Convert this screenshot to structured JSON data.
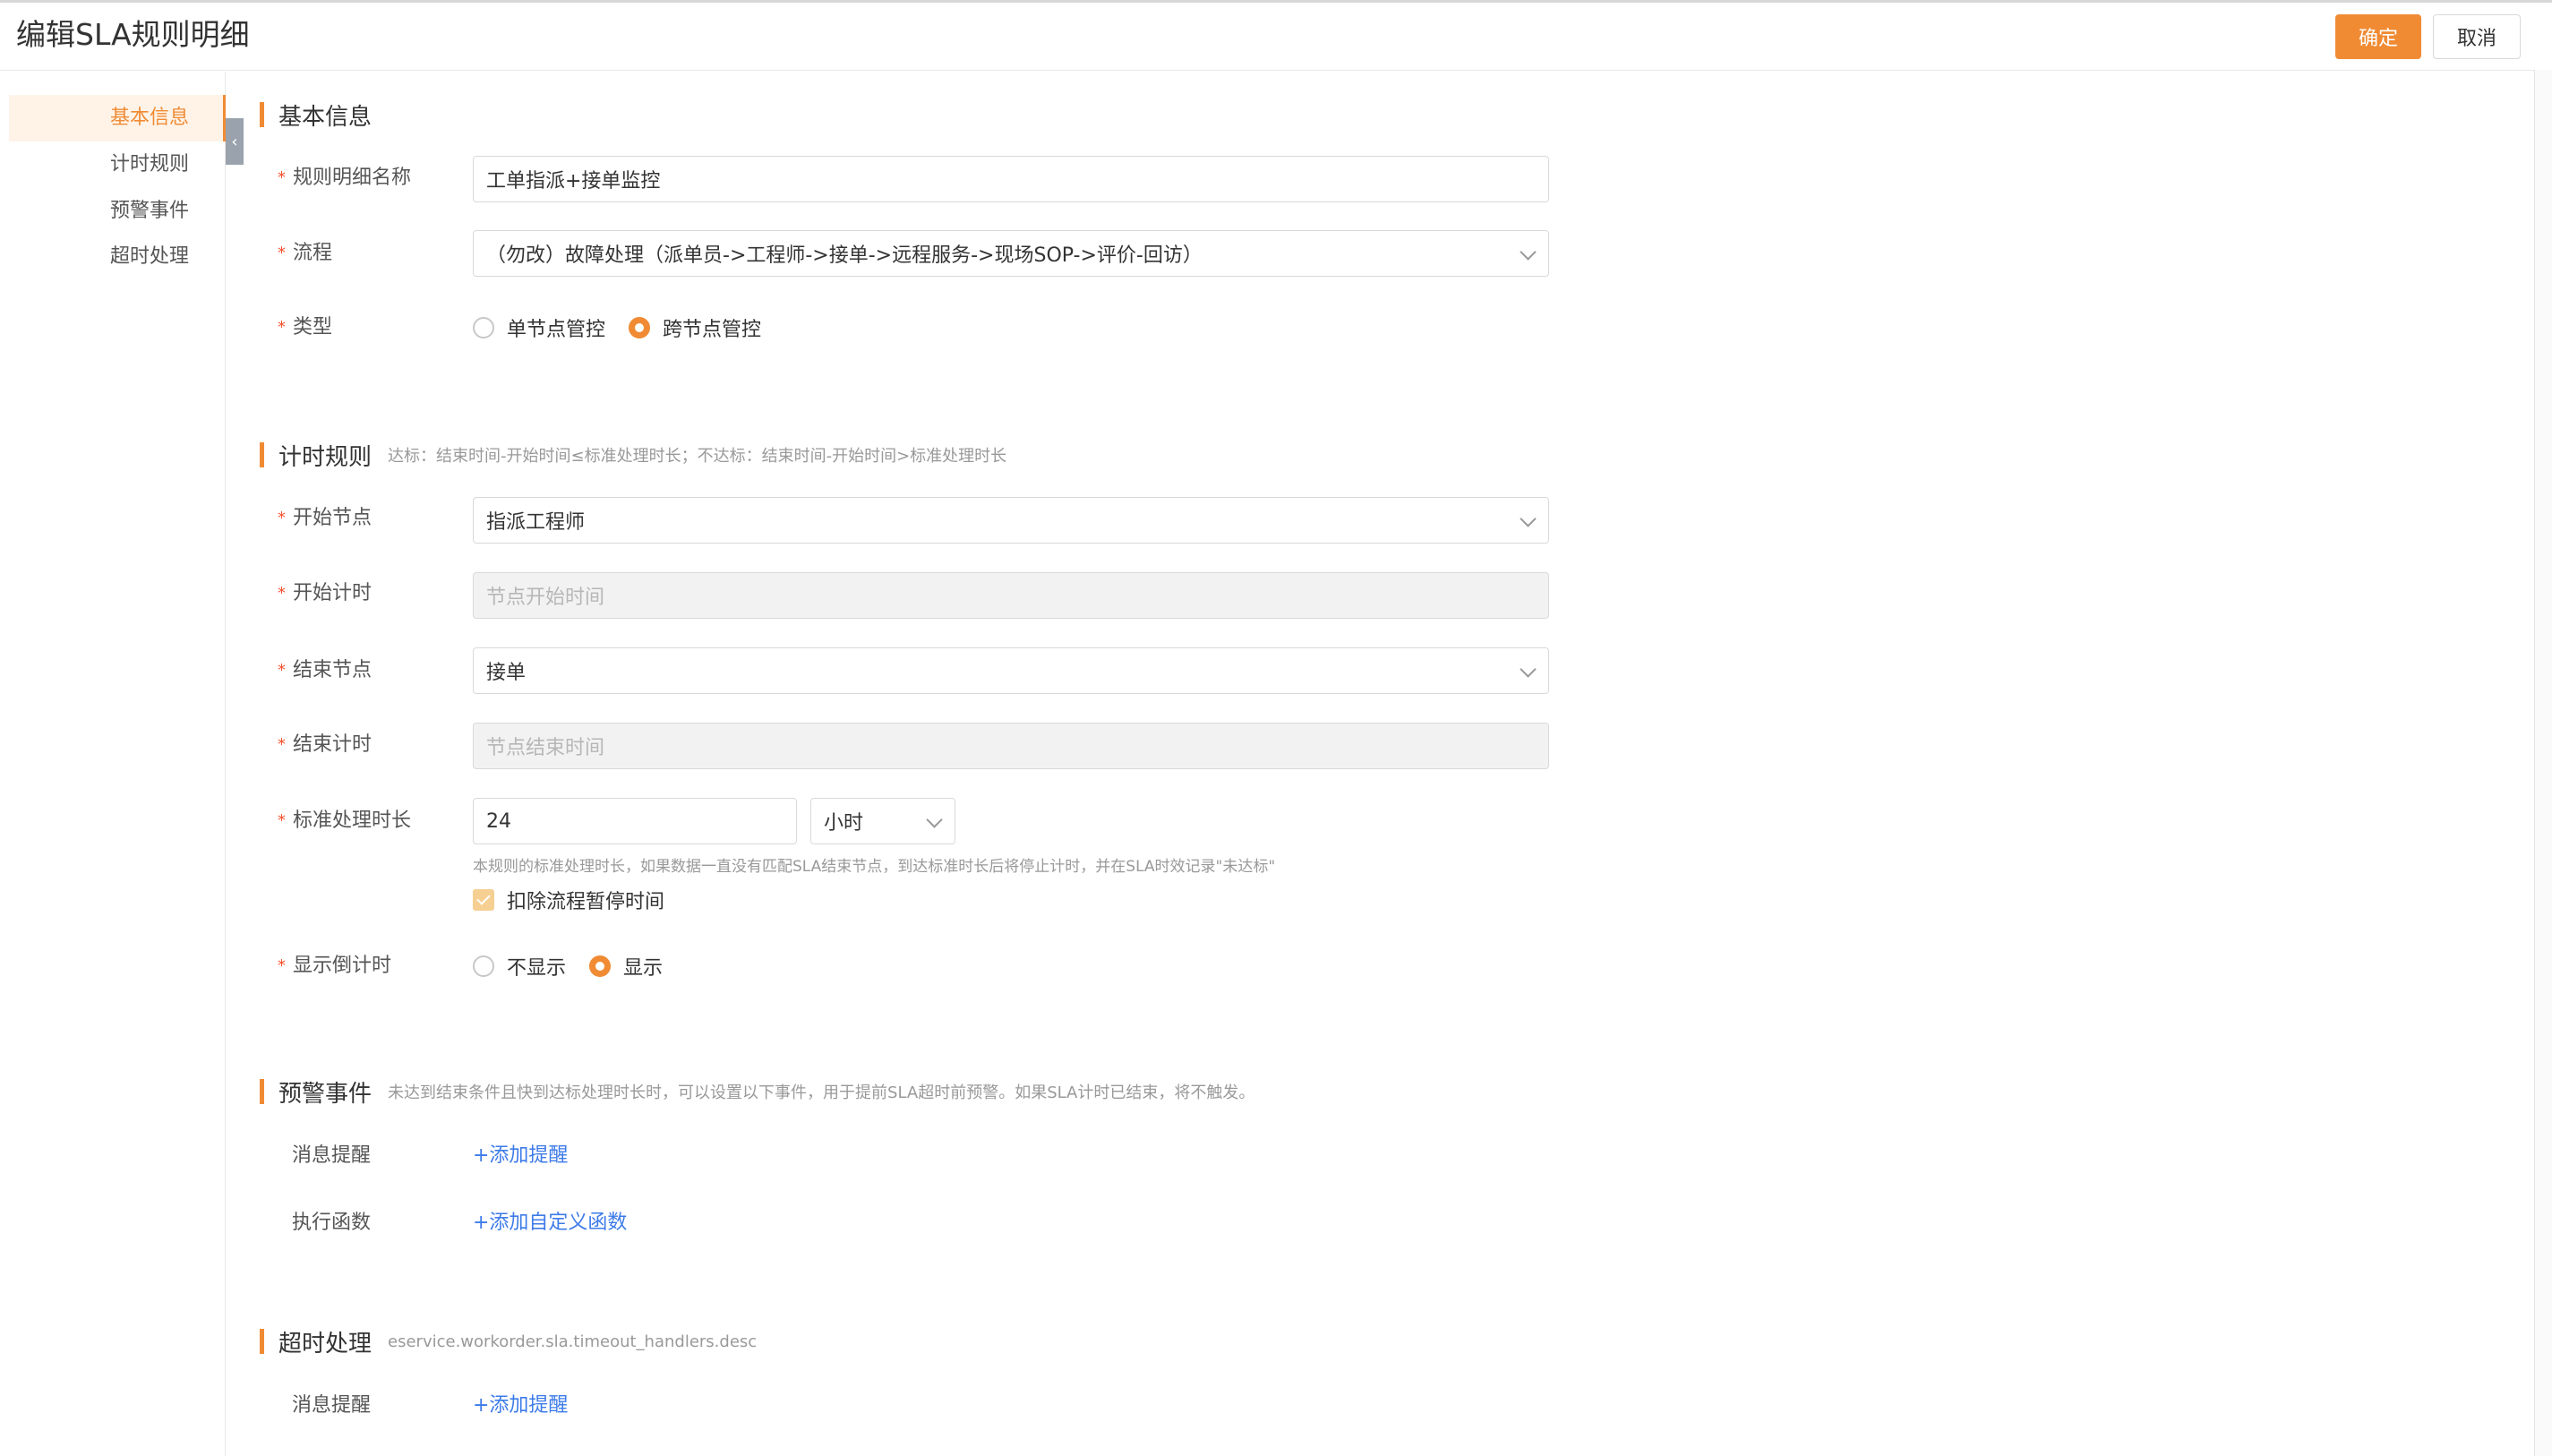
{
  "header": {
    "title": "编辑SLA规则明细",
    "confirm_label": "确定",
    "cancel_label": "取消"
  },
  "sidebar": {
    "items": [
      {
        "label": "基本信息",
        "active": true
      },
      {
        "label": "计时规则",
        "active": false
      },
      {
        "label": "预警事件",
        "active": false
      },
      {
        "label": "超时处理",
        "active": false
      }
    ]
  },
  "basic": {
    "title": "基本信息",
    "name_label": "规则明细名称",
    "name_value": "工单指派+接单监控",
    "process_label": "流程",
    "process_value": "（勿改）故障处理（派单员->工程师->接单->远程服务->现场SOP->评价-回访）",
    "type_label": "类型",
    "type_options": [
      "单节点管控",
      "跨节点管控"
    ],
    "type_selected": "跨节点管控"
  },
  "timing": {
    "title": "计时规则",
    "desc": "达标：结束时间-开始时间≤标准处理时长；不达标：结束时间-开始时间>标准处理时长",
    "start_node_label": "开始节点",
    "start_node_value": "指派工程师",
    "start_time_label": "开始计时",
    "start_time_placeholder": "节点开始时间",
    "end_node_label": "结束节点",
    "end_node_value": "接单",
    "end_time_label": "结束计时",
    "end_time_placeholder": "节点结束时间",
    "duration_label": "标准处理时长",
    "duration_value": "24",
    "duration_unit": "小时",
    "duration_hint": "本规则的标准处理时长，如果数据一直没有匹配SLA结束节点，到达标准时长后将停止计时，并在SLA时效记录\"未达标\"",
    "pause_checkbox_label": "扣除流程暂停时间",
    "pause_checked": true,
    "countdown_label": "显示倒计时",
    "countdown_options": [
      "不显示",
      "显示"
    ],
    "countdown_selected": "显示"
  },
  "warning": {
    "title": "预警事件",
    "desc": "未达到结束条件且快到达标处理时长时，可以设置以下事件，用于提前SLA超时前预警。如果SLA计时已结束，将不触发。",
    "message_label": "消息提醒",
    "add_message": "+添加提醒",
    "function_label": "执行函数",
    "add_function": "+添加自定义函数"
  },
  "timeout": {
    "title": "超时处理",
    "desc": "eservice.workorder.sla.timeout_handlers.desc",
    "message_label": "消息提醒",
    "add_message": "+添加提醒"
  },
  "colors": {
    "accent": "#f08b34",
    "link": "#3d7be8",
    "required": "#f5512d"
  }
}
